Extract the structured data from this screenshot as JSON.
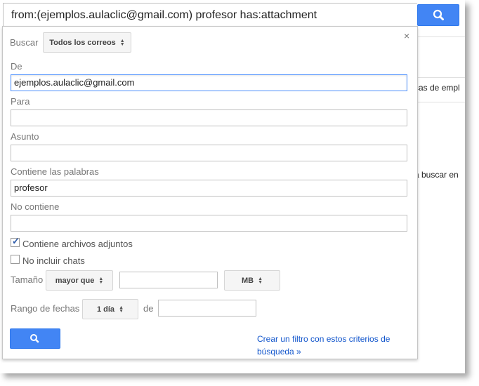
{
  "search": {
    "query": "from:(ejemplos.aulaclic@gmail.com) profesor has:attachment"
  },
  "background": {
    "snippet_1": "cas de empl",
    "snippet_2": "a buscar en"
  },
  "form": {
    "close_label": "×",
    "buscar_label": "Buscar",
    "buscar_scope": "Todos los correos",
    "de_label": "De",
    "de_value": "ejemplos.aulaclic@gmail.com",
    "para_label": "Para",
    "para_value": "",
    "asunto_label": "Asunto",
    "asunto_value": "",
    "contiene_label": "Contiene las palabras",
    "contiene_value": "profesor",
    "no_contiene_label": "No contiene",
    "no_contiene_value": "",
    "adjuntos_label": "Contiene archivos adjuntos",
    "adjuntos_checked": true,
    "no_chats_label": "No incluir chats",
    "no_chats_checked": false,
    "tamano_label": "Tamaño",
    "tamano_op": "mayor que",
    "tamano_value": "",
    "tamano_unit": "MB",
    "rango_label": "Rango de fechas",
    "rango_value": "1 día",
    "de_fecha_label": "de",
    "de_fecha_value": "",
    "filter_link": "Crear un filtro con estos criterios de búsqueda »"
  },
  "icons": {
    "search": "search-icon",
    "close": "close-icon",
    "updown": "up-down-arrows-icon"
  },
  "colors": {
    "primary_button": "#4285f4",
    "link": "#1155cc",
    "focus_border": "#4d90fe"
  }
}
